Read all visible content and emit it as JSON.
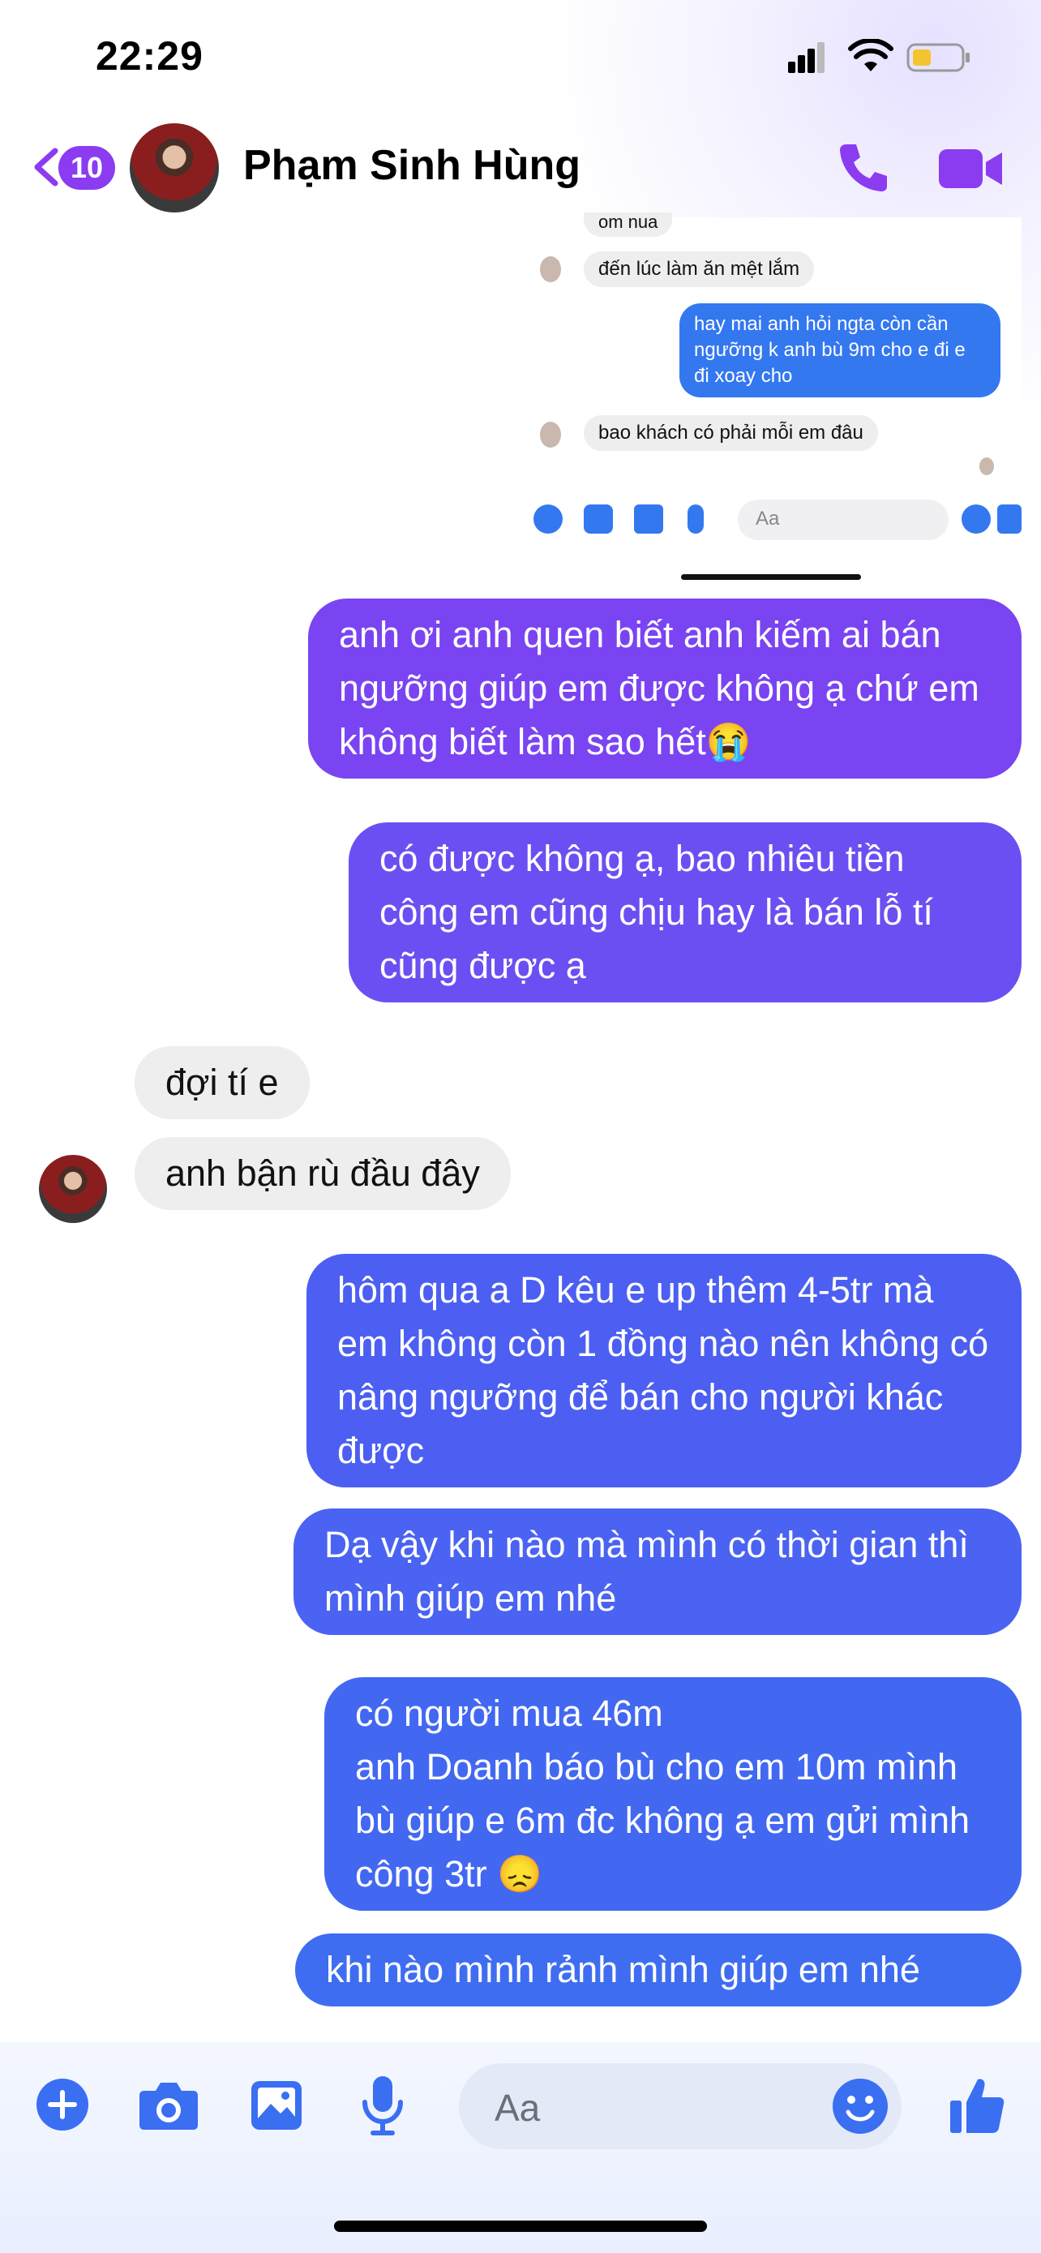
{
  "status_bar": {
    "time": "22:29"
  },
  "header": {
    "back_count": "10",
    "contact_name": "Phạm Sinh Hùng"
  },
  "embedded_screenshot": {
    "partial_text": "om nua",
    "msg_in_1": "đến lúc làm ăn mệt lắm",
    "msg_out_1": "hay mai anh hỏi ngta còn cần ngưỡng k anh bù 9m cho e đi e đi xoay cho",
    "msg_in_2": "bao khách có phải mỗi em đâu",
    "composer_placeholder": "Aa"
  },
  "messages": [
    {
      "side": "out",
      "text": "anh ơi anh quen biết anh kiếm ai bán ngưỡng giúp em được không ạ chứ em không biết làm sao hết😭"
    },
    {
      "side": "out",
      "text": "có được không ạ, bao nhiêu tiền công em cũng chịu hay là bán lỗ tí cũng được ạ"
    },
    {
      "side": "in",
      "text": "đợi tí e"
    },
    {
      "side": "in",
      "text": "anh bận rù đầu đây"
    },
    {
      "side": "out",
      "text": "hôm qua a D kêu e up thêm 4-5tr mà em không còn 1 đồng nào nên không có nâng ngưỡng để bán cho người khác được"
    },
    {
      "side": "out",
      "text": "Dạ vậy khi nào mà mình có thời gian thì mình giúp em nhé"
    },
    {
      "side": "out",
      "text": "có người mua 46m\nanh Doanh báo bù cho em 10m mình bù giúp e 6m đc không ạ em gửi mình công 3tr  😞"
    },
    {
      "side": "out",
      "text": "khi nào mình rảnh mình giúp em nhé"
    }
  ],
  "composer": {
    "placeholder": "Aa"
  },
  "colors": {
    "accent": "#8b3cf0",
    "bubble_purple": "#7a44f2",
    "bubble_blue": "#3f6df2",
    "incoming": "#eeeeef"
  }
}
